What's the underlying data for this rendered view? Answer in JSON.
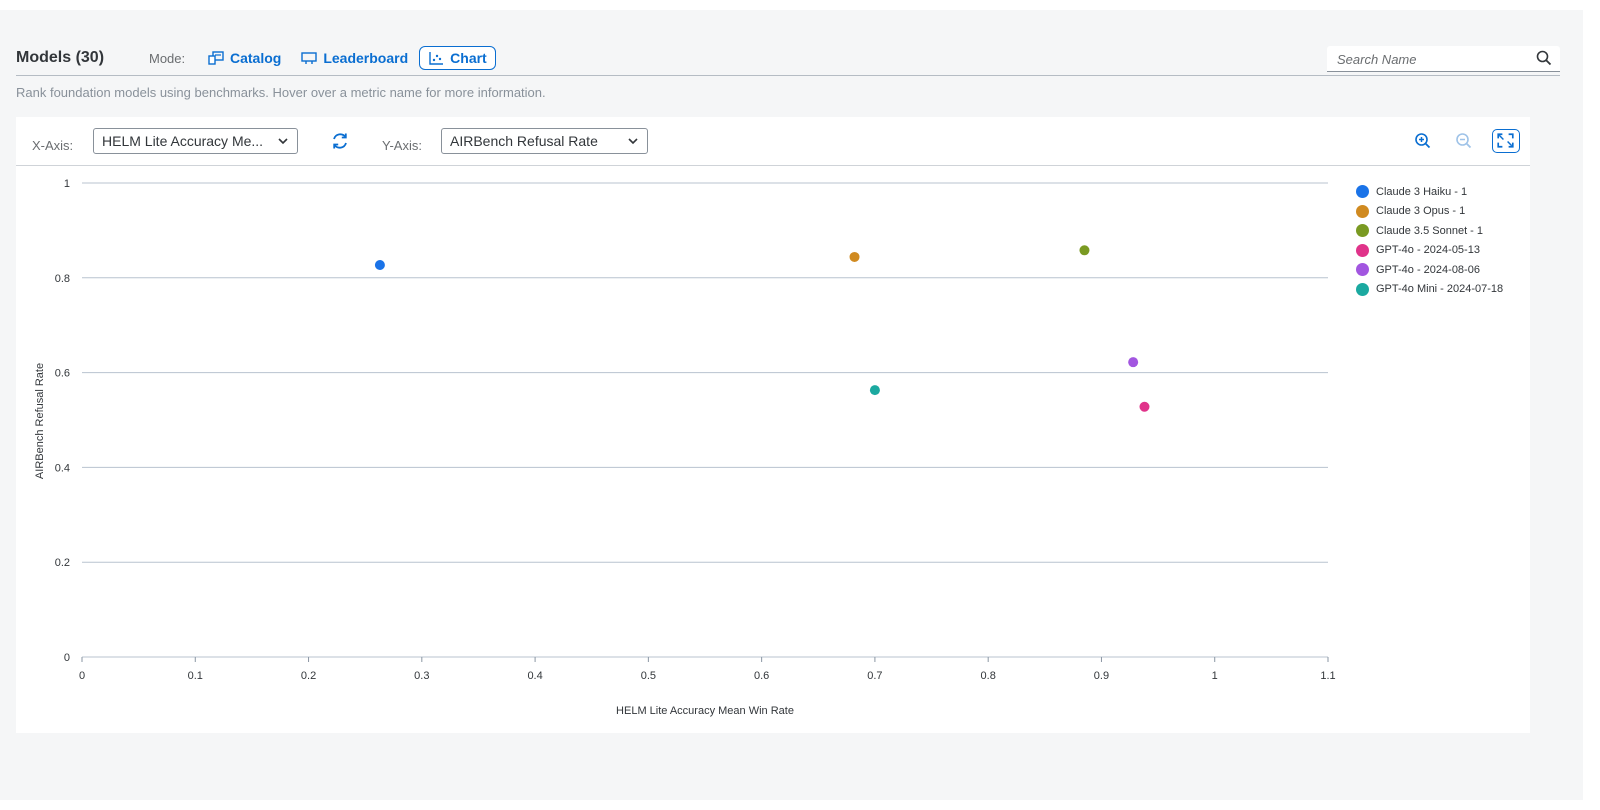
{
  "header": {
    "title": "Models (30)",
    "mode_label": "Mode:",
    "modes": [
      {
        "label": "Catalog",
        "icon": "catalog-icon",
        "active": false
      },
      {
        "label": "Leaderboard",
        "icon": "leaderboard-icon",
        "active": false
      },
      {
        "label": "Chart",
        "icon": "chart-icon",
        "active": true
      }
    ],
    "search_placeholder": "Search Name",
    "subtitle": "Rank foundation models using benchmarks. Hover over a metric name for more information."
  },
  "toolbar": {
    "x_axis_label": "X-Axis:",
    "x_axis_value": "HELM Lite Accuracy Me...",
    "y_axis_label": "Y-Axis:",
    "y_axis_value": "AIRBench Refusal Rate",
    "icons": [
      "refresh-icon",
      "zoom-in-icon",
      "zoom-out-icon",
      "fullscreen-icon"
    ]
  },
  "colors": {
    "accent": "#0a6ed1"
  },
  "chart_data": {
    "type": "scatter",
    "xlabel": "HELM Lite Accuracy Mean Win Rate",
    "ylabel": "AIRBench Refusal Rate",
    "xlim": [
      0,
      1.1
    ],
    "ylim": [
      0,
      1
    ],
    "x_ticks": [
      "0",
      "0.1",
      "0.2",
      "0.3",
      "0.4",
      "0.5",
      "0.6",
      "0.7",
      "0.8",
      "0.9",
      "1",
      "1.1"
    ],
    "y_ticks": [
      "0",
      "0.2",
      "0.4",
      "0.6",
      "0.8",
      "1"
    ],
    "grid": "horizontal",
    "legend_position": "right",
    "series": [
      {
        "name": "Claude 3 Haiku - 1",
        "color": "#1a73e8",
        "x": 0.263,
        "y": 0.827
      },
      {
        "name": "Claude 3 Opus - 1",
        "color": "#d08a20",
        "x": 0.682,
        "y": 0.844
      },
      {
        "name": "Claude 3.5 Sonnet - 1",
        "color": "#7a9a22",
        "x": 0.885,
        "y": 0.858
      },
      {
        "name": "GPT-4o - 2024-05-13",
        "color": "#e0338a",
        "x": 0.938,
        "y": 0.528
      },
      {
        "name": "GPT-4o - 2024-08-06",
        "color": "#a256e0",
        "x": 0.928,
        "y": 0.622
      },
      {
        "name": "GPT-4o Mini - 2024-07-18",
        "color": "#1ba9a0",
        "x": 0.7,
        "y": 0.563
      }
    ]
  }
}
